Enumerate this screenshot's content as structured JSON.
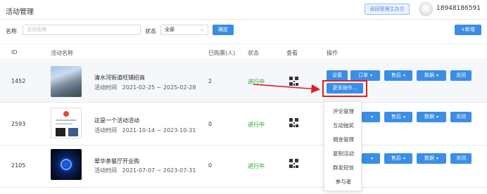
{
  "header": {
    "title": "活动管理",
    "return_label": "返回管理主办方",
    "phone": "18948186591",
    "caret": "⌄"
  },
  "filter": {
    "name_label": "名称",
    "name_placeholder": "活动名称",
    "status_label": "状态",
    "status_value": "全部",
    "confirm": "确定",
    "new": "+新增"
  },
  "table": {
    "headers": {
      "id": "ID",
      "name": "活动名称",
      "sold": "已购票(人)",
      "status": "状态",
      "view": "查看",
      "ops": "操作"
    },
    "time_label": "活动时间",
    "rows": [
      {
        "id": "1452",
        "name": "清水河街道旺铺招商",
        "time": "2021-02-25 ~ 2025-02-28",
        "sold": "2",
        "status": "进行中"
      },
      {
        "id": "2593",
        "name": "这是一个活动活动",
        "time": "2021-10-14 ~ 2023-10-31",
        "sold": "0",
        "status": "进行中"
      },
      {
        "id": "2105",
        "name": "翠华茶餐厅开业购",
        "time": "2021-07-07 ~ 2023-07-31",
        "sold": "0",
        "status": "进行中"
      }
    ]
  },
  "actions": {
    "settings": "设置",
    "orders": "订单",
    "aftersale": "售后",
    "data": "数据",
    "close": "关闭",
    "more": "更多操作..."
  },
  "more_menu": [
    "评论管理",
    "互动抽奖",
    "佣金管理",
    "复制活动",
    "群发短信",
    "参与者"
  ],
  "colors": {
    "primary": "#3a8ee6",
    "status_green": "#1aad19",
    "highlight": "#e02020"
  }
}
